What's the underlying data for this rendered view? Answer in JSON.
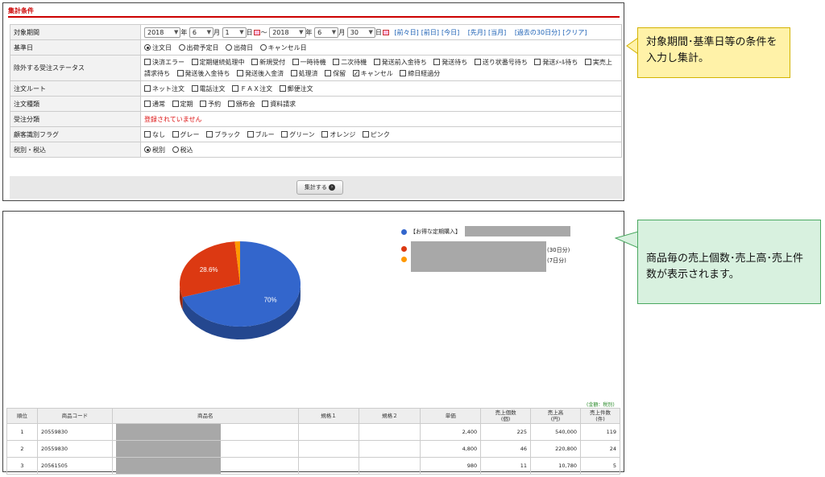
{
  "conditions": {
    "title": "集計条件",
    "rows": {
      "period": {
        "label": "対象期間",
        "from": {
          "year": "2018",
          "month": "6",
          "day": "1"
        },
        "to": {
          "year": "2018",
          "month": "6",
          "day": "30"
        },
        "unit_year": "年",
        "unit_month": "月",
        "unit_day": "日",
        "tilde": "～",
        "links": [
          "[前々日]",
          "[前日]",
          "[今日]",
          "[先月]",
          "[当月]",
          "[過去の30日分]",
          "[クリア]"
        ]
      },
      "base_date": {
        "label": "基準日",
        "options": [
          "注文日",
          "出荷予定日",
          "出荷日",
          "キャンセル日"
        ],
        "selected": 0
      },
      "exclude_status": {
        "label": "除外する受注ステータス",
        "options": [
          "決済エラー",
          "定期継続処理中",
          "新規受付",
          "一時待機",
          "二次待機",
          "発送前入金待ち",
          "発送待ち",
          "送り状番号待ち",
          "発送ﾒｰﾙ待ち",
          "実売上請求待ち",
          "発送後入金待ち",
          "発送後入金済",
          "処理済",
          "保留",
          "キャンセル",
          "締日経過分"
        ],
        "checked": [
          14
        ]
      },
      "order_route": {
        "label": "注文ルート",
        "options": [
          "ネット注文",
          "電話注文",
          "ＦＡＸ注文",
          "郵便注文"
        ]
      },
      "order_type": {
        "label": "注文種類",
        "options": [
          "通常",
          "定期",
          "予約",
          "頒布会",
          "資料請求"
        ]
      },
      "order_class": {
        "label": "受注分類",
        "value": "登録されていません"
      },
      "customer_flag": {
        "label": "顧客識別フラグ",
        "options": [
          "なし",
          "グレー",
          "ブラック",
          "ブルー",
          "グリーン",
          "オレンジ",
          "ピンク"
        ]
      },
      "tax": {
        "label": "税別・税込",
        "options": [
          "税別",
          "税込"
        ],
        "selected": 0
      }
    },
    "aggregate_button": "集計する"
  },
  "callouts": {
    "top": "対象期間･基準日等の条件を入力し集計。",
    "bottom": "商品毎の売上個数･売上高･売上件数が表示されます。"
  },
  "chart_data": {
    "type": "pie",
    "slices": [
      {
        "label": "【お得な定期購入】",
        "value": 70,
        "color": "#3366cc",
        "data_label": "70%"
      },
      {
        "label": "(30日分)",
        "value": 28.6,
        "color": "#dc3912",
        "data_label": "28.6%"
      },
      {
        "label": "(7日分)",
        "value": 1.4,
        "color": "#ff9900",
        "data_label": ""
      }
    ],
    "legend_position": "top-right"
  },
  "results": {
    "unit_note": "(金額：税別)",
    "headers": [
      "順位",
      "商品コード",
      "商品名",
      "規格１",
      "規格２",
      "単価",
      "売上個数\n(個)",
      "売上高\n(円)",
      "売上件数\n(件)"
    ],
    "rows": [
      {
        "rank": "1",
        "code": "20559830",
        "price": "2,400",
        "qty": "225",
        "sales": "540,000",
        "count": "119"
      },
      {
        "rank": "2",
        "code": "20559830",
        "price": "4,800",
        "qty": "46",
        "sales": "220,800",
        "count": "24"
      },
      {
        "rank": "3",
        "code": "20561505",
        "price": "980",
        "qty": "11",
        "sales": "10,780",
        "count": "5"
      }
    ]
  }
}
